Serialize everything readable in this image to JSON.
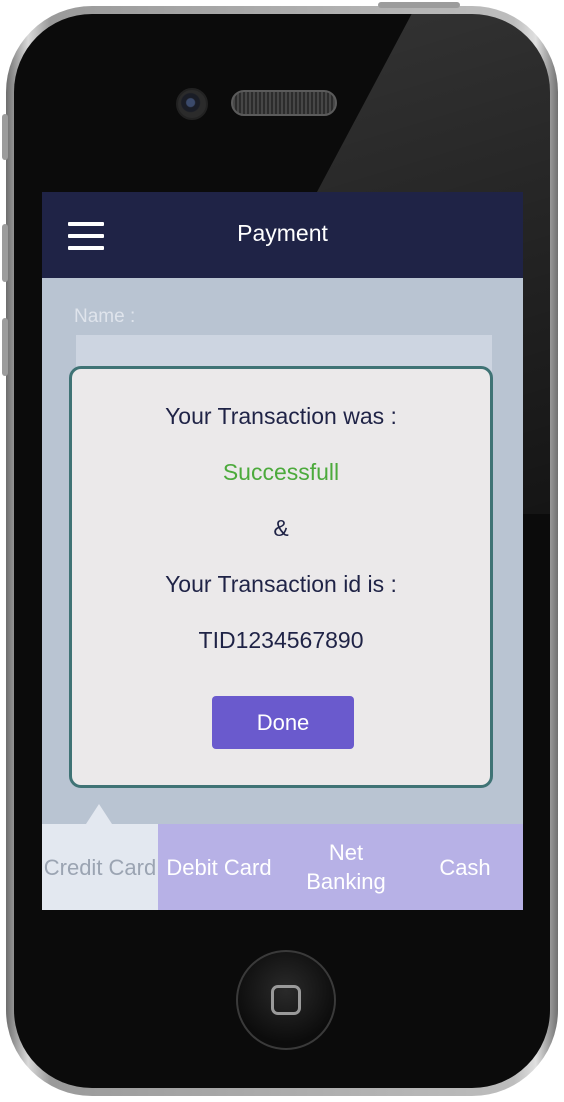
{
  "header": {
    "title": "Payment",
    "menu_icon": "hamburger-menu-icon"
  },
  "form": {
    "name_label": "Name :",
    "name_value": ""
  },
  "dialog": {
    "line1": "Your Transaction was :",
    "status": "Successfull",
    "status_color": "#4caa3c",
    "ampersand": "&",
    "line2": "Your Transaction id is :",
    "transaction_id": "TID1234567890",
    "done_label": "Done"
  },
  "tabs": [
    {
      "label": "Credit Card",
      "active": true
    },
    {
      "label": "Debit Card",
      "active": false
    },
    {
      "label": "Net Banking",
      "active": false
    },
    {
      "label": "Cash",
      "active": false
    }
  ],
  "colors": {
    "header_bg": "#1f2346",
    "screen_bg": "#b9c4d2",
    "dialog_border": "#3f7375",
    "button_bg": "#6a5acd",
    "tab_bar_bg": "#b7b1e6",
    "tab_active_bg": "#e3e8f0"
  }
}
